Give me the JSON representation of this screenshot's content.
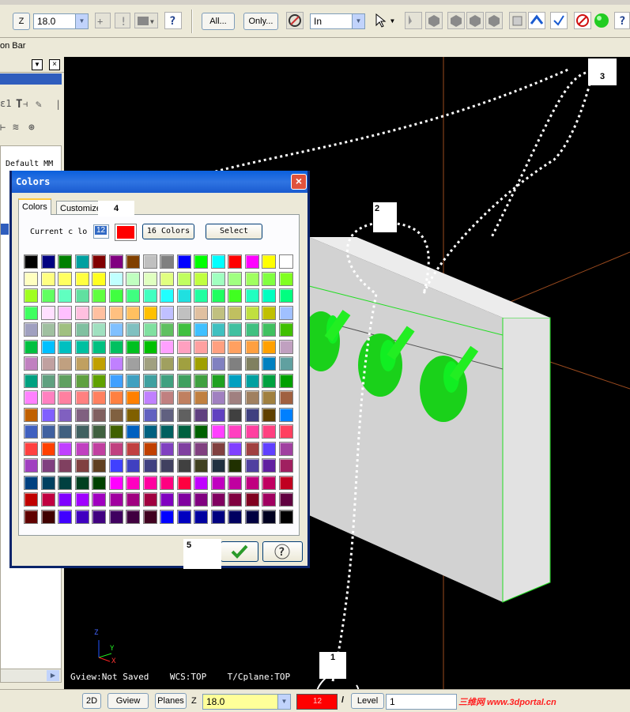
{
  "toolbar": {
    "z_label": "Z",
    "z_value": "18.0",
    "all_button": "All...",
    "only_button": "Only...",
    "layer_mode_value": "In"
  },
  "left_panel": {
    "title": "on Bar",
    "item_label": "Default MM"
  },
  "viewport": {
    "status_text": "Gview:Not Saved    WCS:TOP    T/Cplane:TOP",
    "axis_labels": [
      "Z",
      "Y",
      "X"
    ]
  },
  "statusbar": {
    "btn_2d": "2D",
    "btn_gview": "Gview",
    "btn_planes": "Planes",
    "z_label": "Z",
    "z_value": "18.0",
    "color_value": "12",
    "level_label": "Level",
    "level_value": "1",
    "watermark": "三维网 www.3dportal.cn"
  },
  "dialog": {
    "title": "Colors",
    "tabs": [
      "Colors",
      "Customize"
    ],
    "current_label": "Current c lo",
    "current_value": "12",
    "btn_16_colors": "16 Colors",
    "btn_select": "Select",
    "ok_icon": "checkmark-icon",
    "help_icon": "question-icon"
  },
  "palette": [
    [
      "#000000",
      "#000080",
      "#008000",
      "#00a0a0",
      "#800000",
      "#800080",
      "#804000",
      "#c0c0c0",
      "#808080",
      "#0000ff",
      "#00ff00",
      "#00ffff",
      "#ff0000",
      "#ff00ff",
      "#ffff00",
      "#ffffff"
    ],
    [
      "#ffffc0",
      "#ffff80",
      "#ffff60",
      "#ffff40",
      "#ffff20",
      "#c0ffff",
      "#c0ffc0",
      "#e0ffc0",
      "#e0ff80",
      "#c0ff60",
      "#c0ff40",
      "#a0ffc0",
      "#a0ff80",
      "#a0ff60",
      "#80ff40",
      "#80ff20"
    ],
    [
      "#a0ff20",
      "#60ff60",
      "#60ffc0",
      "#60e0a0",
      "#60ff40",
      "#40ff40",
      "#40ff80",
      "#40ffc0",
      "#20ffff",
      "#20e0e0",
      "#20ffa0",
      "#20ff60",
      "#40ff20",
      "#20ffc0",
      "#00ffc0",
      "#00ff80"
    ],
    [
      "#40ff60",
      "#ffe0ff",
      "#ffc0ff",
      "#ffc0e0",
      "#ffc0a0",
      "#ffc080",
      "#ffc060",
      "#ffc000",
      "#c0c0ff",
      "#c0c0c0",
      "#e0c0a0",
      "#c0c080",
      "#c0c060",
      "#c0e040",
      "#c0c000",
      "#a0c0ff"
    ],
    [
      "#a0a0c0",
      "#a0c0a0",
      "#a0c080",
      "#80c0a0",
      "#a0e0c0",
      "#80c0ff",
      "#80c0c0",
      "#80e0a0",
      "#60c060",
      "#40c040",
      "#40c0ff",
      "#40c0c0",
      "#40c0a0",
      "#40c080",
      "#40c060",
      "#40c000"
    ],
    [
      "#00c040",
      "#00c0ff",
      "#00c0c0",
      "#00c0a0",
      "#00c080",
      "#00c060",
      "#00c020",
      "#00c000",
      "#ffa0ff",
      "#ffa0c0",
      "#ffa0a0",
      "#ffa080",
      "#ffa060",
      "#ffa040",
      "#ffa000",
      "#c0a0c0"
    ],
    [
      "#c080c0",
      "#c0a0a0",
      "#c0a080",
      "#c0a060",
      "#c0a000",
      "#c080ff",
      "#a0a0a0",
      "#a0a080",
      "#a0a060",
      "#a0a040",
      "#a0a000",
      "#8080c0",
      "#808080",
      "#808060",
      "#0080c0",
      "#60a0a0"
    ],
    [
      "#00a080",
      "#60a080",
      "#60a060",
      "#60a040",
      "#60a000",
      "#40a0ff",
      "#40a0c0",
      "#40a0a0",
      "#40a080",
      "#40a060",
      "#40a040",
      "#20a020",
      "#00a0c0",
      "#00a0a0",
      "#00a040",
      "#00a000"
    ],
    [
      "#ff80ff",
      "#ff80c0",
      "#ff80a0",
      "#ff8080",
      "#ff8060",
      "#ff8040",
      "#ff8000",
      "#c080ff",
      "#c08080",
      "#c08060",
      "#c08040",
      "#a080c0",
      "#a08080",
      "#a08060",
      "#a08040",
      "#a06040"
    ],
    [
      "#c06000",
      "#8060ff",
      "#8060c0",
      "#806080",
      "#806060",
      "#806040",
      "#806000",
      "#6060c0",
      "#606080",
      "#606060",
      "#604080",
      "#6040c0",
      "#404040",
      "#404080",
      "#604000",
      "#0080ff"
    ],
    [
      "#4060c0",
      "#4060a0",
      "#406080",
      "#406060",
      "#406040",
      "#406000",
      "#0060c0",
      "#006080",
      "#006060",
      "#006040",
      "#006000",
      "#ff40ff",
      "#ff40c0",
      "#ff40a0",
      "#ff4080",
      "#ff4060"
    ],
    [
      "#ff4040",
      "#ff4000",
      "#c040ff",
      "#c040c0",
      "#c040a0",
      "#c04080",
      "#c04040",
      "#c04000",
      "#8040c0",
      "#8040a0",
      "#804080",
      "#804040",
      "#8040ff",
      "#a04040",
      "#6040ff",
      "#a040a0"
    ],
    [
      "#a040c0",
      "#804080",
      "#804060",
      "#804040",
      "#604020",
      "#4040ff",
      "#4040c0",
      "#404080",
      "#404060",
      "#404040",
      "#404020",
      "#203040",
      "#203000",
      "#5040a0",
      "#6020a0",
      "#a02060"
    ],
    [
      "#004080",
      "#004060",
      "#004040",
      "#004020",
      "#004000",
      "#ff00ff",
      "#ff00c0",
      "#ff00a0",
      "#ff0080",
      "#ff0040",
      "#c000ff",
      "#c000c0",
      "#c000a0",
      "#c00080",
      "#c00060",
      "#c00020"
    ],
    [
      "#c00000",
      "#c00040",
      "#8000ff",
      "#a000ff",
      "#a000c0",
      "#a000a0",
      "#a00080",
      "#a00040",
      "#8000c0",
      "#8000a0",
      "#800080",
      "#800060",
      "#800040",
      "#800020",
      "#a00060",
      "#600040"
    ],
    [
      "#600000",
      "#400000",
      "#4000ff",
      "#4000c0",
      "#400080",
      "#400060",
      "#400040",
      "#400020",
      "#0000ff",
      "#0000c0",
      "#0000a0",
      "#000080",
      "#000060",
      "#000040",
      "#000020",
      "#000000"
    ]
  ],
  "annotations": [
    "1",
    "2",
    "3",
    "4",
    "5"
  ],
  "colors": {
    "selected": "#ff0000",
    "title_bar": "#0a5fdc",
    "part_green": "#11e01a",
    "viewport": "#000000"
  }
}
